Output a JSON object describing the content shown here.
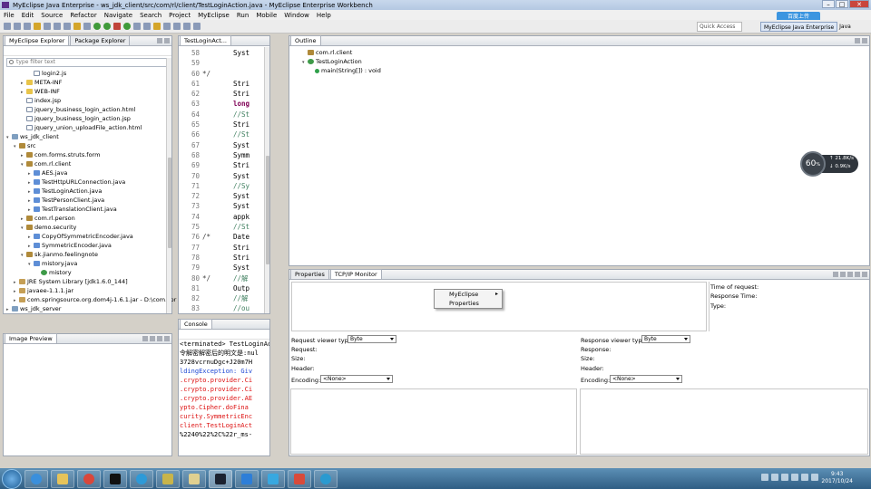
{
  "window": {
    "title": "MyEclipse Java Enterprise - ws_jdk_client/src/com/rl/client/TestLoginAction.java - MyEclipse Enterprise Workbench"
  },
  "menu": [
    "File",
    "Edit",
    "Source",
    "Refactor",
    "Navigate",
    "Search",
    "Project",
    "MyEclipse",
    "Run",
    "Mobile",
    "Window",
    "Help"
  ],
  "quick_access": "Quick Access",
  "perspectives": [
    "MyEclipse Java Enterprise",
    "Java"
  ],
  "cloud_button": "百度上传",
  "explorer": {
    "tabs": [
      "MyEclipse Explorer",
      "Package Explorer"
    ],
    "filter_placeholder": "type filter text",
    "items": [
      {
        "label": "login2.js",
        "depth": 3,
        "icon": "file"
      },
      {
        "label": "META-INF",
        "depth": 2,
        "icon": "folder",
        "arrow": "▸"
      },
      {
        "label": "WEB-INF",
        "depth": 2,
        "icon": "folder",
        "arrow": "▸"
      },
      {
        "label": "index.jsp",
        "depth": 2,
        "icon": "file"
      },
      {
        "label": "jquery_business_login_action.html",
        "depth": 2,
        "icon": "file"
      },
      {
        "label": "jquery_business_login_action.jsp",
        "depth": 2,
        "icon": "file"
      },
      {
        "label": "jquery_union_uploadFile_action.html",
        "depth": 2,
        "icon": "file"
      },
      {
        "label": "ws_jdk_client",
        "depth": 0,
        "icon": "project",
        "arrow": "▾"
      },
      {
        "label": "src",
        "depth": 1,
        "icon": "package",
        "arrow": "▾"
      },
      {
        "label": "com.forms.struts.form",
        "depth": 2,
        "icon": "package",
        "arrow": "▸"
      },
      {
        "label": "com.rl.client",
        "depth": 2,
        "icon": "package",
        "arrow": "▾"
      },
      {
        "label": "AES.java",
        "depth": 3,
        "icon": "java",
        "arrow": "▸"
      },
      {
        "label": "TestHttpURLConnection.java",
        "depth": 3,
        "icon": "java",
        "arrow": "▸"
      },
      {
        "label": "TestLoginAction.java",
        "depth": 3,
        "icon": "java",
        "arrow": "▸"
      },
      {
        "label": "TestPersonClient.java",
        "depth": 3,
        "icon": "java",
        "arrow": "▸"
      },
      {
        "label": "TestTranslationClient.java",
        "depth": 3,
        "icon": "java",
        "arrow": "▸"
      },
      {
        "label": "com.rl.person",
        "depth": 2,
        "icon": "package",
        "arrow": "▸"
      },
      {
        "label": "demo.security",
        "depth": 2,
        "icon": "package",
        "arrow": "▾"
      },
      {
        "label": "CopyOfSymmetricEncoder.java",
        "depth": 3,
        "icon": "java",
        "arrow": "▸"
      },
      {
        "label": "SymmetricEncoder.java",
        "depth": 3,
        "icon": "java",
        "arrow": "▸"
      },
      {
        "label": "sk.jianmo.feelingnote",
        "depth": 2,
        "icon": "package",
        "arrow": "▾"
      },
      {
        "label": "mistory.java",
        "depth": 3,
        "icon": "java",
        "arrow": "▾"
      },
      {
        "label": "mistory",
        "depth": 4,
        "icon": "class"
      },
      {
        "label": "JRE System Library [jdk1.6.0_144]",
        "depth": 1,
        "icon": "jar",
        "arrow": "▸"
      },
      {
        "label": "javaee-1.1.1.jar",
        "depth": 1,
        "icon": "jar",
        "arrow": "▸"
      },
      {
        "label": "com.springsource.org.dom4j-1.6.1.jar - D:\\com.spr",
        "depth": 1,
        "icon": "jar",
        "arrow": "▸"
      },
      {
        "label": "ws_jdk_server",
        "depth": 0,
        "icon": "project",
        "arrow": "▸"
      }
    ]
  },
  "image_preview": {
    "tab": "Image Preview"
  },
  "editor": {
    "tab": "TestLoginAct...",
    "lines": [
      {
        "n": "58",
        "m": "",
        "t": "Syst",
        "c": "tx"
      },
      {
        "n": "59",
        "m": "",
        "t": "",
        "c": "tx"
      },
      {
        "n": "60",
        "m": "*/",
        "t": "",
        "c": "tx"
      },
      {
        "n": "61",
        "m": "",
        "t": "Stri",
        "c": "tx"
      },
      {
        "n": "62",
        "m": "",
        "t": "Stri",
        "c": "tx"
      },
      {
        "n": "63",
        "m": "",
        "t": "long",
        "c": "tx kw"
      },
      {
        "n": "64",
        "m": "",
        "t": "//St",
        "c": "tx cmt"
      },
      {
        "n": "65",
        "m": "",
        "t": "Stri",
        "c": "tx"
      },
      {
        "n": "66",
        "m": "",
        "t": "//St",
        "c": "tx cmt"
      },
      {
        "n": "67",
        "m": "",
        "t": "Syst",
        "c": "tx"
      },
      {
        "n": "68",
        "m": "",
        "t": "Symm",
        "c": "tx"
      },
      {
        "n": "69",
        "m": "",
        "t": "Stri",
        "c": "tx"
      },
      {
        "n": "70",
        "m": "",
        "t": "Syst",
        "c": "tx"
      },
      {
        "n": "71",
        "m": "",
        "t": "//Sy",
        "c": "tx cmt"
      },
      {
        "n": "72",
        "m": "",
        "t": "Syst",
        "c": "tx"
      },
      {
        "n": "73",
        "m": "",
        "t": "Syst",
        "c": "tx"
      },
      {
        "n": "74",
        "m": "",
        "t": "appk",
        "c": "tx"
      },
      {
        "n": "75",
        "m": "",
        "t": "//St",
        "c": "tx cmt"
      },
      {
        "n": "76",
        "m": "/*",
        "t": "Date",
        "c": "tx"
      },
      {
        "n": "77",
        "m": "",
        "t": "Stri",
        "c": "tx"
      },
      {
        "n": "78",
        "m": "",
        "t": "Stri",
        "c": "tx"
      },
      {
        "n": "79",
        "m": "",
        "t": "Syst",
        "c": "tx"
      },
      {
        "n": "80",
        "m": "*/",
        "t": "//解",
        "c": "tx cmt"
      },
      {
        "n": "81",
        "m": "",
        "t": "Outp",
        "c": "tx"
      },
      {
        "n": "82",
        "m": "",
        "t": "//解",
        "c": "tx cmt"
      },
      {
        "n": "83",
        "m": "",
        "t": "//ou",
        "c": "tx cmt"
      }
    ]
  },
  "console": {
    "tab": "Console",
    "header": "<terminated> TestLoginAction [Jav",
    "lines": [
      {
        "t": "令解密解密后的明文是:nul",
        "c": ""
      },
      {
        "t": "3728vcrnuDgc+J20m7H",
        "c": ""
      },
      {
        "t": "ldingException: Giv",
        "c": "lnk"
      },
      {
        "t": ".crypto.provider.Ci",
        "c": "err"
      },
      {
        "t": ".crypto.provider.Ci",
        "c": "err"
      },
      {
        "t": ".crypto.provider.AE",
        "c": "err"
      },
      {
        "t": "ypto.Cipher.doFina",
        "c": "err"
      },
      {
        "t": "curity.SymmetricEnc",
        "c": "err"
      },
      {
        "t": "client.TestLoginAct",
        "c": "err"
      },
      {
        "t": "%2240%22%2C%22r_ms-",
        "c": ""
      }
    ]
  },
  "outline": {
    "tab": "Outline",
    "items": [
      {
        "label": "com.rl.client",
        "depth": 0,
        "icon": "package"
      },
      {
        "label": "TestLoginAction",
        "depth": 0,
        "icon": "class",
        "arrow": "▾"
      },
      {
        "label": "main(String[]) : void",
        "depth": 1,
        "icon": "method"
      }
    ]
  },
  "speed_widget": {
    "percent": "60",
    "unit": "%",
    "up": "21.8",
    "down": "0.9",
    "rate_unit": "K/s"
  },
  "tcp": {
    "tabs": [
      "Properties",
      "TCP/IP Monitor"
    ],
    "time_label": "Time of request:",
    "resp_time_label": "Response Time:",
    "type_label": "Type:",
    "req_viewer_label": "Request viewer type:",
    "req_viewer_value": "Byte",
    "resp_viewer_label": "Response viewer type:",
    "resp_viewer_value": "Byte",
    "request_label": "Request:",
    "response_label": "Response:",
    "size_label": "Size:",
    "header_label": "Header:",
    "encoding_label": "Encoding:",
    "encoding_value": "<None>"
  },
  "context_menu": {
    "items": [
      "MyEclipse",
      "Properties"
    ],
    "submenu_arrow": "▸"
  },
  "taskbar": {
    "time": "9:43",
    "date": "2017/10/24"
  }
}
